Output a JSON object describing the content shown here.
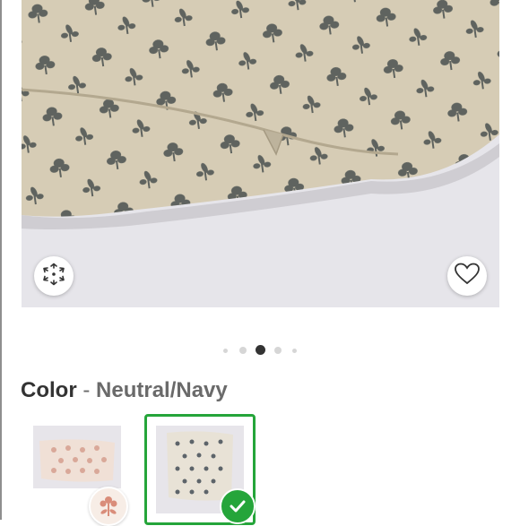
{
  "product_image": {
    "alt": "",
    "ar_icon": "ar-view-icon",
    "favorite_icon": "heart-icon"
  },
  "carousel": {
    "total_dots": 5,
    "active_index": 2
  },
  "color": {
    "label": "Color",
    "separator": "-",
    "selected_value": "Neutral/Navy"
  },
  "swatches": [
    {
      "icon": "pink-floral-pattern-swatch",
      "selected": false,
      "color": "#e9c8b8"
    },
    {
      "icon": "neutral-navy-pattern-swatch",
      "selected": true,
      "color": "#2f3a4a"
    }
  ],
  "colors": {
    "selected_border": "#25a53a",
    "text_primary": "#333333",
    "text_secondary": "#6a6a6a",
    "active_dot": "#333333",
    "inactive_dot": "#d6d6d6"
  }
}
